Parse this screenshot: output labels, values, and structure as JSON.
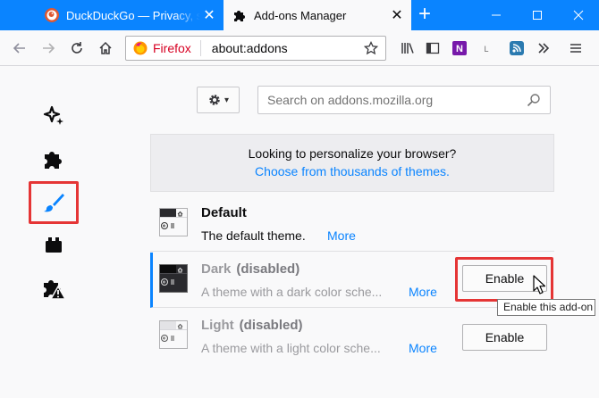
{
  "tabs": [
    {
      "title": "DuckDuckGo — Privacy, simplified.",
      "icon": "duckduckgo-icon",
      "active": false
    },
    {
      "title": "Add-ons Manager",
      "icon": "puzzle-icon",
      "active": true
    }
  ],
  "urlbar": {
    "identity_label": "Firefox",
    "url": "about:addons"
  },
  "toolbar": {
    "search_placeholder": "Search on addons.mozilla.org"
  },
  "promo": {
    "line1": "Looking to personalize your browser?",
    "link": "Choose from thousands of themes."
  },
  "categories": [
    {
      "name": "discover",
      "icon": "sparkle-icon"
    },
    {
      "name": "extensions",
      "icon": "puzzle-icon"
    },
    {
      "name": "themes",
      "icon": "paintbrush-icon",
      "selected": true
    },
    {
      "name": "plugins",
      "icon": "plugin-icon"
    },
    {
      "name": "legacy",
      "icon": "puzzle-warning-icon"
    }
  ],
  "themes": [
    {
      "name": "Default",
      "status": "",
      "description": "The default theme.",
      "more": "More",
      "button": ""
    },
    {
      "name": "Dark",
      "status": "(disabled)",
      "description": "A theme with a dark color sche...",
      "more": "More",
      "button": "Enable"
    },
    {
      "name": "Light",
      "status": "(disabled)",
      "description": "A theme with a light color sche...",
      "more": "More",
      "button": "Enable"
    }
  ],
  "tooltip": "Enable this add-on",
  "colors": {
    "accent": "#0a84ff",
    "highlight": "#e53535"
  }
}
